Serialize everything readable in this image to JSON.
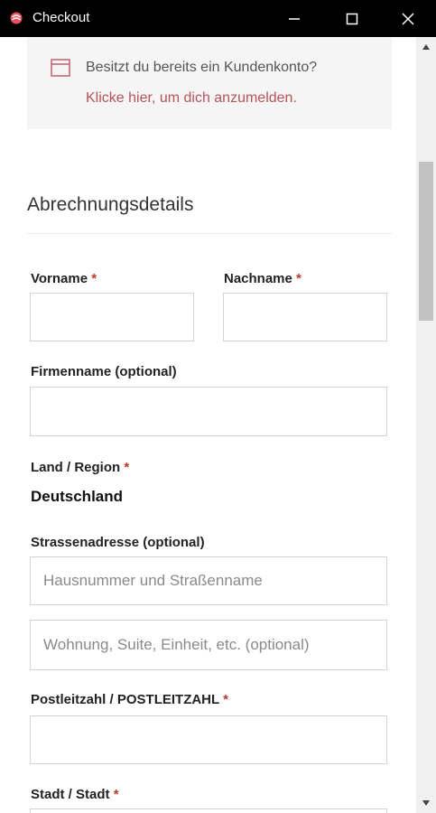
{
  "window": {
    "title": "Checkout"
  },
  "login_notice": {
    "text": "Besitzt du bereits ein Kundenkonto?",
    "link": "Klicke hier, um dich anzumelden."
  },
  "billing": {
    "title": "Abrechnungsdetails",
    "first_name": {
      "label": "Vorname",
      "value": ""
    },
    "last_name": {
      "label": "Nachname",
      "value": ""
    },
    "company": {
      "label": "Firmenname (optional)",
      "value": ""
    },
    "country": {
      "label": "Land / Region",
      "value": "Deutschland"
    },
    "street": {
      "label": "Strassenadresse (optional)",
      "line1_placeholder": "Hausnummer und Straßenname",
      "line2_placeholder": "Wohnung, Suite, Einheit, etc. (optional)"
    },
    "postcode": {
      "label": "Postleitzahl / POSTLEITZAHL",
      "value": ""
    },
    "city": {
      "label": "Stadt / Stadt"
    },
    "required_marker": "*"
  },
  "colors": {
    "titlebar": "#000000",
    "link": "#b5535b",
    "required": "#c0392b",
    "notice_bg": "#f6f5f5"
  }
}
